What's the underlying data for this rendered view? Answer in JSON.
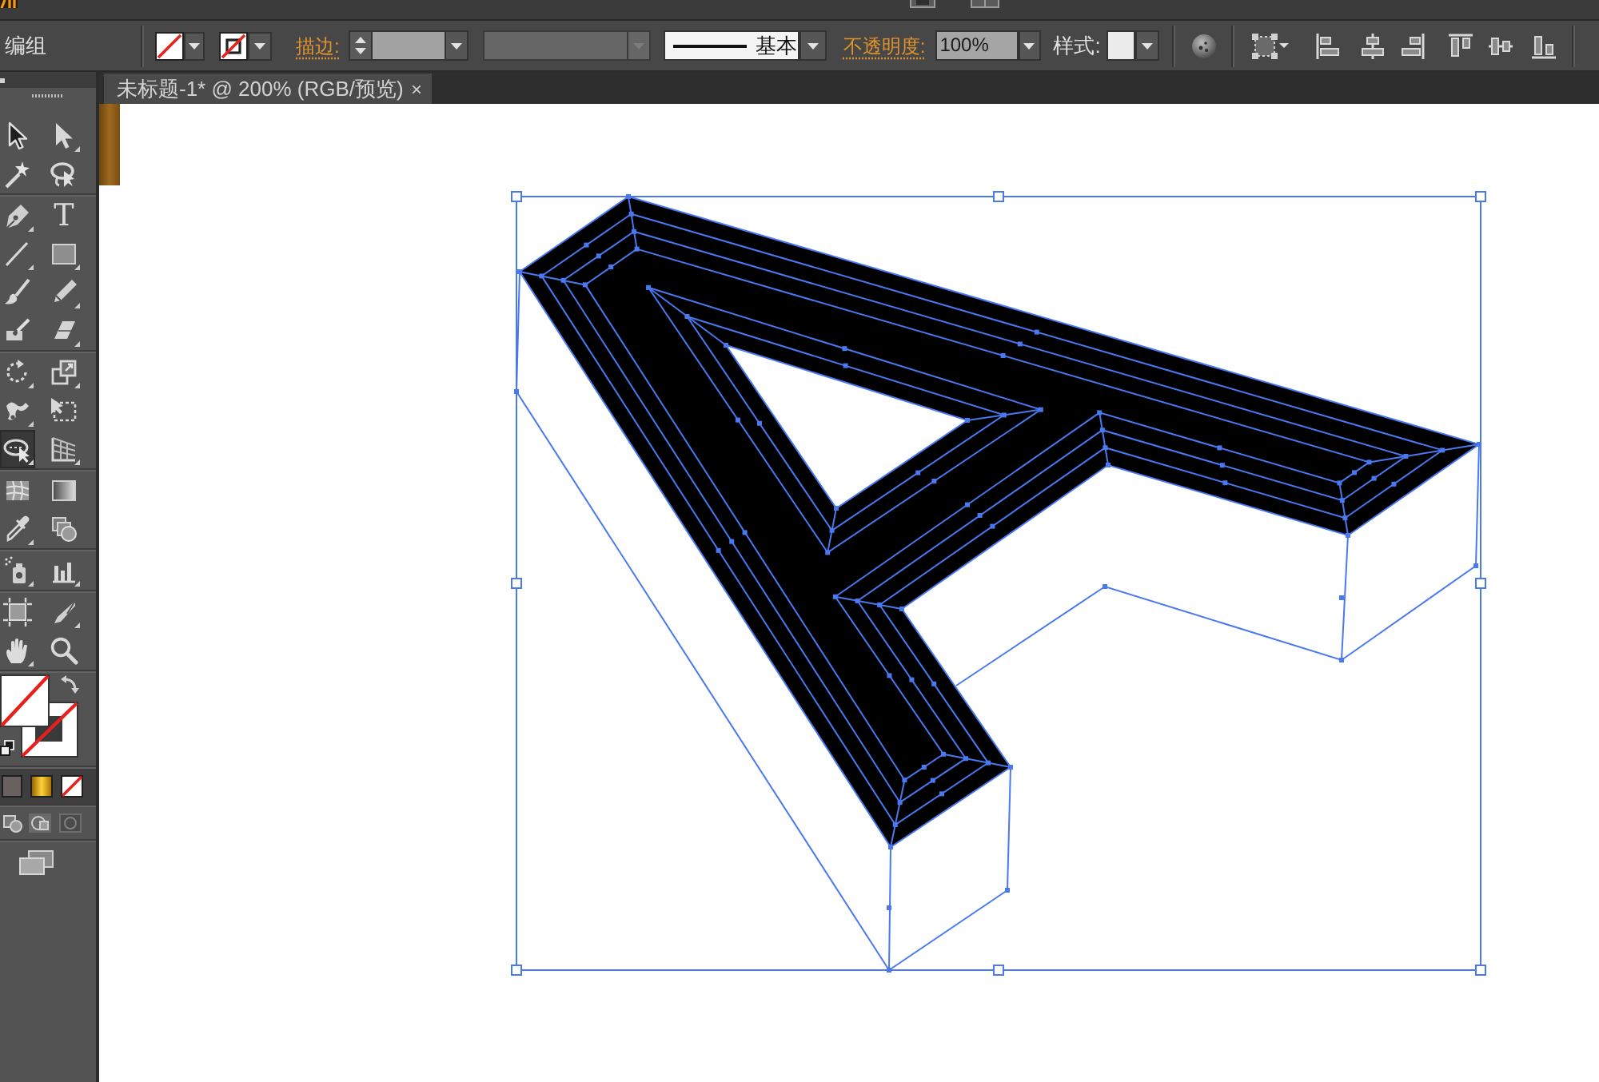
{
  "control_bar": {
    "selection_label": "编组",
    "fill": {
      "kind": "none"
    },
    "stroke": {
      "kind": "none"
    },
    "stroke_link": "描边:",
    "profile_dropdown": {
      "disabled": true
    },
    "brush": {
      "name": "基本"
    },
    "opacity_link": "不透明度:",
    "opacity": {
      "value": "100%"
    },
    "style_label": "样式:"
  },
  "document_tab": {
    "title": "未标题-1* @ 200% (RGB/预览)",
    "close": "×"
  },
  "toolbox": {
    "tool_groups": [
      {
        "tools": [
          {
            "kind": "select",
            "selected": false
          },
          {
            "kind": "direct",
            "selected": false
          },
          {
            "kind": "wand",
            "selected": false
          },
          {
            "kind": "lasso",
            "selected": false
          }
        ]
      },
      {
        "tools": [
          {
            "kind": "pen",
            "selected": false
          },
          {
            "kind": "type",
            "label": "T",
            "selected": false
          },
          {
            "kind": "line",
            "selected": false
          },
          {
            "kind": "rectangle",
            "selected": false
          },
          {
            "kind": "brush",
            "selected": false
          },
          {
            "kind": "pencil",
            "selected": false
          },
          {
            "kind": "blob",
            "selected": false
          },
          {
            "kind": "eraser",
            "selected": false
          }
        ]
      },
      {
        "tools": [
          {
            "kind": "rotate",
            "selected": false
          },
          {
            "kind": "scale",
            "selected": false
          },
          {
            "kind": "warp",
            "selected": false
          },
          {
            "kind": "freetransform",
            "selected": false
          },
          {
            "kind": "shapebuilder",
            "selected": true
          },
          {
            "kind": "perspective",
            "selected": false
          }
        ]
      },
      {
        "tools": [
          {
            "kind": "mesh",
            "selected": false
          },
          {
            "kind": "gradient",
            "selected": false
          },
          {
            "kind": "eyedropper",
            "selected": false
          },
          {
            "kind": "blend",
            "selected": false
          }
        ]
      },
      {
        "tools": [
          {
            "kind": "symbol",
            "selected": false
          },
          {
            "kind": "graph",
            "selected": false
          }
        ]
      },
      {
        "tools": [
          {
            "kind": "artboard",
            "selected": false
          },
          {
            "kind": "slice",
            "selected": false
          },
          {
            "kind": "hand",
            "selected": false
          },
          {
            "kind": "zoom",
            "selected": false
          }
        ]
      }
    ],
    "fill": {
      "kind": "none"
    },
    "stroke": {
      "kind": "none"
    }
  }
}
